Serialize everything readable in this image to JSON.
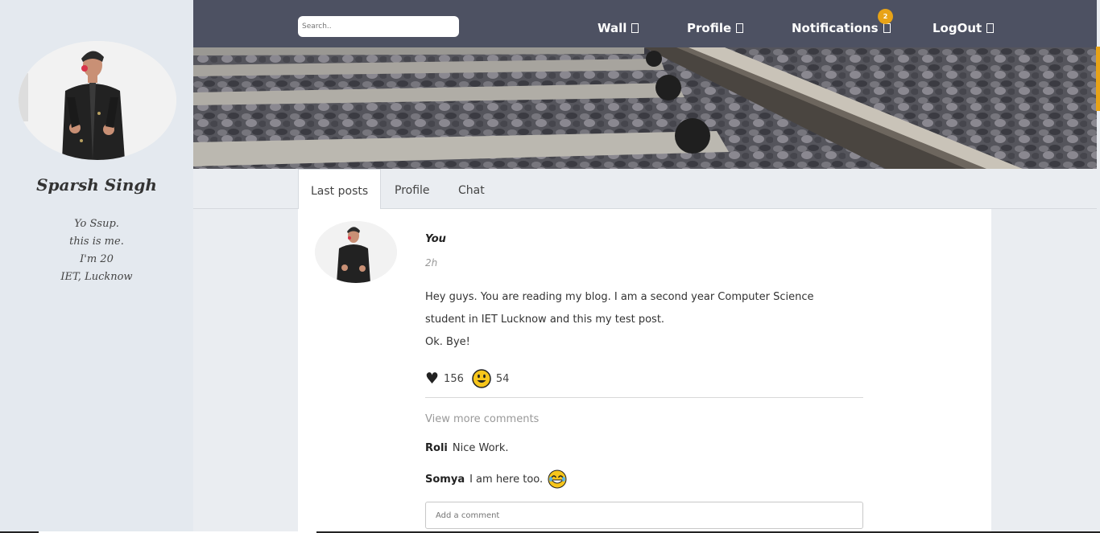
{
  "sidebar": {
    "name": "Sparsh Singh",
    "bio": [
      "Yo Ssup.",
      "this is me.",
      "I'm 20",
      "IET, Lucknow"
    ]
  },
  "nav": {
    "search_placeholder": "Search..",
    "items": [
      {
        "label": "Wall",
        "icon": "wall-icon"
      },
      {
        "label": "Profile",
        "icon": "profile-icon"
      },
      {
        "label": "Notifications",
        "icon": "bell-icon"
      },
      {
        "label": "LogOut",
        "icon": "logout-icon"
      }
    ],
    "notification_count": "2"
  },
  "tabs": [
    {
      "label": "Last posts",
      "active": true
    },
    {
      "label": "Profile",
      "active": false
    },
    {
      "label": "Chat",
      "active": false
    }
  ],
  "post": {
    "author": "You",
    "time": "2h",
    "body_lines": [
      "Hey guys. You are reading my blog. I am a second year Computer Science",
      "student in IET Lucknow and this my test post.",
      "Ok. Bye!"
    ],
    "likes": "156",
    "smiles": "54",
    "view_more": "View more comments",
    "comments": [
      {
        "author": "Roli",
        "text": "Nice Work."
      },
      {
        "author": "Somya",
        "text": "I am here too."
      }
    ],
    "comment_placeholder": "Add a comment"
  },
  "colors": {
    "nav_bg": "#4d5162",
    "sidebar_bg": "#e4e9ef",
    "page_bg": "#eaedf1",
    "badge": "#e8a317"
  }
}
